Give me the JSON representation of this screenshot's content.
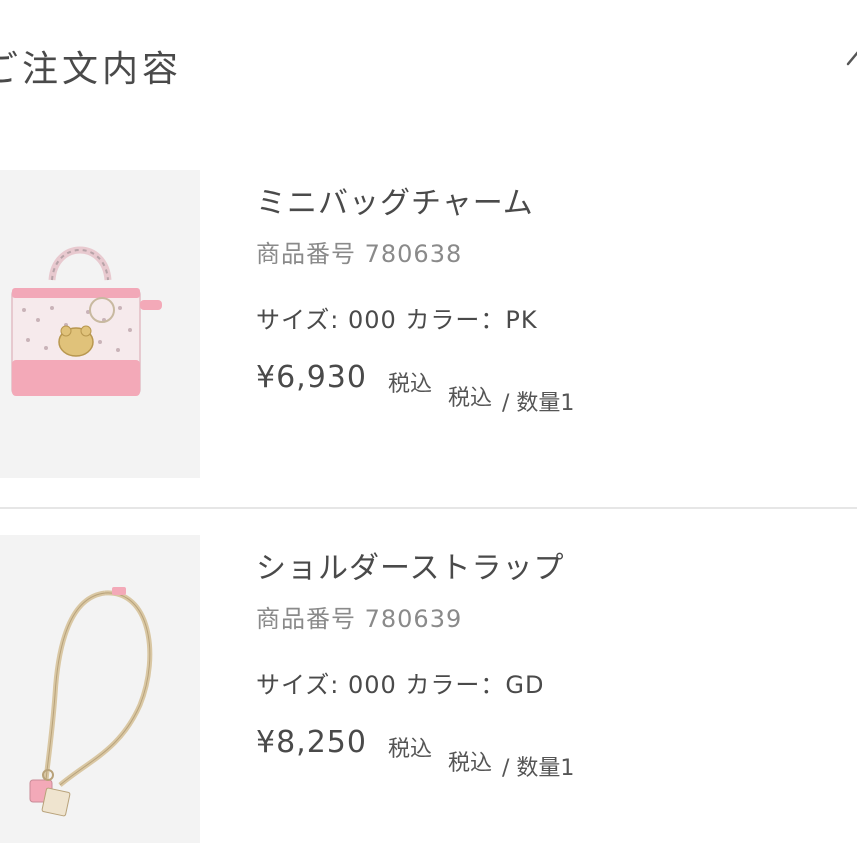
{
  "header": {
    "title": "ご注文内容"
  },
  "items": [
    {
      "name": "ミニバッグチャーム",
      "code": "商品番号 780638",
      "spec": "サイズ: 000 カラー：PK",
      "price": "¥6,930",
      "tax_label": "税込",
      "tax_label_2": "税込",
      "quantity": "/ 数量1",
      "image": "mini-bag-charm-image"
    },
    {
      "name": "ショルダーストラップ",
      "code": "商品番号 780639",
      "spec": "サイズ: 000 カラー：GD",
      "price": "¥8,250",
      "tax_label": "税込",
      "tax_label_2": "税込",
      "quantity": "/ 数量1",
      "image": "shoulder-strap-image"
    }
  ],
  "colors": {
    "text": "#4a4a4a",
    "muted": "#8a8a8a",
    "thumb_bg": "#f3f3f3",
    "divider": "#e6e6e6",
    "pink": "#f3a9b8"
  }
}
